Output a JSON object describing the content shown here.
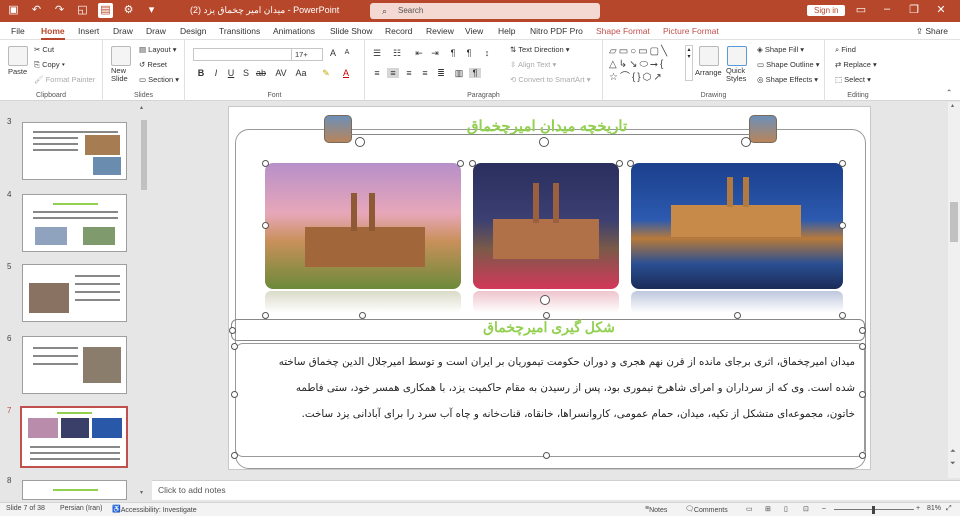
{
  "titlebar": {
    "doc_title": "میدان امیر چخماق یزد (2)  -  PowerPoint",
    "search_placeholder": "Search",
    "signin": "Sign in"
  },
  "menu": {
    "items": [
      "File",
      "Home",
      "Insert",
      "Draw",
      "Draw",
      "Design",
      "Transitions",
      "Animations",
      "Slide Show",
      "Record",
      "Review",
      "View",
      "Help",
      "Nitro PDF Pro"
    ],
    "context": [
      "Shape Format",
      "Picture Format"
    ],
    "share": "Share"
  },
  "ribbon": {
    "clipboard": {
      "label": "Clipboard",
      "paste": "Paste",
      "cut": "Cut",
      "copy": "Copy",
      "format_painter": "Format Painter"
    },
    "slides": {
      "label": "Slides",
      "new_slide": "New Slide",
      "layout": "Layout",
      "reset": "Reset",
      "section": "Section"
    },
    "font": {
      "label": "Font",
      "size": "17+"
    },
    "paragraph": {
      "label": "Paragraph",
      "text_direction": "Text Direction",
      "align_text": "Align Text",
      "convert": "Convert to SmartArt"
    },
    "drawing": {
      "label": "Drawing",
      "arrange": "Arrange",
      "quick_styles": "Quick Styles",
      "shape_fill": "Shape Fill",
      "shape_outline": "Shape Outline",
      "shape_effects": "Shape Effects"
    },
    "editing": {
      "label": "Editing",
      "find": "Find",
      "replace": "Replace",
      "select": "Select"
    }
  },
  "thumbnails": [
    {
      "num": "3"
    },
    {
      "num": "4"
    },
    {
      "num": "5"
    },
    {
      "num": "6"
    },
    {
      "num": "7"
    },
    {
      "num": "8"
    }
  ],
  "slide": {
    "title": "تاریخچه میدان امیرچخماق",
    "subtitle": "شکل گیری امیرچخماق",
    "body_lines": [
      "میدان امیرچخماق، اثری برجای مانده از قرن نهم هجری و دوران حکومت تیموریان بر ایران است و توسط امیرجلال الدین چخماق ساخته",
      "شده است. وی که از سرداران و امرای شاهرخ تیموری بود، پس از رسیدن به مقام حاکمیت یزد، با همکاری همسر خود، ستی فاطمه",
      "خاتون، مجموعه‌ای متشکل از تکیه، میدان، حمام عمومی، کاروانسراها، خانقاه، قنات‌خانه و چاه آب سرد را برای آبادانی یزد ساخت."
    ],
    "title_color": "#92d050"
  },
  "notes_placeholder": "Click to add notes",
  "status": {
    "slide": "Slide 7 of 38",
    "language": "Persian (Iran)",
    "accessibility": "Accessibility: Investigate",
    "notes": "Notes",
    "comments": "Comments",
    "zoom": "81%"
  }
}
